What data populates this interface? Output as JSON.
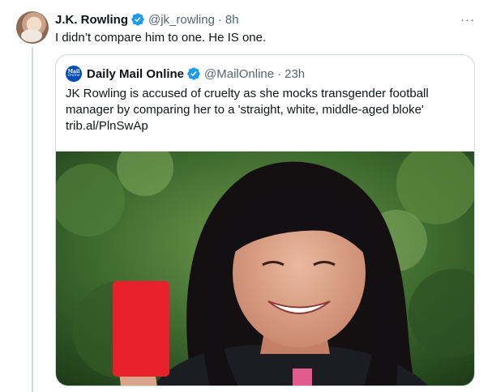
{
  "tweet": {
    "display_name": "J.K. Rowling",
    "handle": "@jk_rowling",
    "separator": "·",
    "time": "8h",
    "text": "I didn’t compare him to one. He IS one.",
    "more_icon": "···"
  },
  "quoted_tweet": {
    "logo_line1": "Mail",
    "logo_line2": "Online",
    "display_name": "Daily Mail Online",
    "handle": "@MailOnline",
    "separator": "·",
    "time": "23h",
    "text_line1": "JK Rowling is accused of cruelty as she mocks transgender football",
    "text_line2": "manager by comparing her to a 'straight, white, middle-aged bloke'",
    "text_line3": "trib.al/PlnSwAp"
  },
  "icons": {
    "verified": "verified-badge-icon",
    "more": "more-options-icon"
  },
  "colors": {
    "verified_blue": "#1d9bf0",
    "secondary_text": "#536471",
    "border": "#cfd9de",
    "red_card": "#e8202e"
  }
}
